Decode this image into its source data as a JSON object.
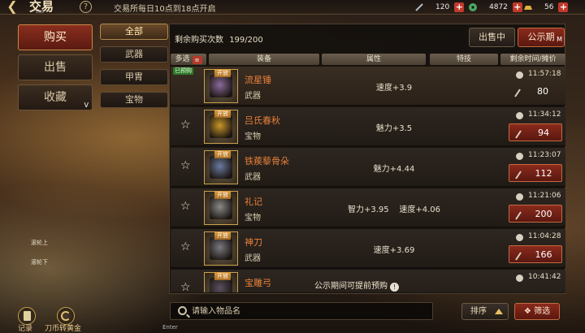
{
  "topbar": {
    "back_icon": "back-arrow-icon",
    "title": "交易",
    "help_glyph": "?",
    "esc_label": "Esc",
    "notice": "交易所每日10点到18点开启",
    "currencies": [
      {
        "icon": "dagger-token-icon",
        "value": "120",
        "color": "#b0b8c0"
      },
      {
        "icon": "jade-coin-icon",
        "value": "4872",
        "color": "#4caa66"
      },
      {
        "icon": "gold-ingot-icon",
        "value": "56",
        "color": "#e0b040"
      }
    ],
    "plus_glyph": "+"
  },
  "left_menu": {
    "buy": "购买",
    "sell": "出售",
    "favorites": "收藏",
    "v_hint": "V"
  },
  "categories": {
    "all": "全部",
    "weapon": "武器",
    "armor": "甲胄",
    "treasure": "宝物"
  },
  "panel": {
    "remaining_label": "剩余购买次数",
    "remaining_value": "199/200",
    "selling_btn": "出售中",
    "public_btn": "公示期",
    "m_hint": "M",
    "headers": {
      "multi": "多选",
      "multi_icon": "list-icon",
      "equip": "装备",
      "attr": "属性",
      "special": "特技",
      "time_price": "剩余时间/摊价"
    },
    "preorder_tag": "已预购",
    "open_tag": "开放"
  },
  "items": [
    {
      "name": "流星锤",
      "type": "武器",
      "attr": "速度+3.9",
      "time": "11:57:18",
      "price": "80",
      "starred": false,
      "preorder": true,
      "art": "#8a6a9a"
    },
    {
      "name": "吕氏春秋",
      "type": "宝物",
      "attr": "魅力+3.5",
      "time": "11:34:12",
      "price": "94",
      "starred": true,
      "preorder": false,
      "art": "#c9962a"
    },
    {
      "name": "铁蒺藜骨朵",
      "type": "武器",
      "attr": "魅力+4.44",
      "time": "11:23:07",
      "price": "112",
      "starred": true,
      "preorder": false,
      "art": "#6a7aa0"
    },
    {
      "name": "礼记",
      "type": "宝物",
      "attr": "智力+3.95    速度+4.06",
      "time": "11:21:06",
      "price": "200",
      "starred": true,
      "preorder": false,
      "art": "#8a8a88"
    },
    {
      "name": "神刀",
      "type": "武器",
      "attr": "速度+3.69",
      "time": "11:04:28",
      "price": "166",
      "starred": true,
      "preorder": false,
      "art": "#7a7a80"
    },
    {
      "name": "宝雕弓",
      "type": "",
      "attr": "",
      "time": "10:41:42",
      "price": "",
      "starred": true,
      "preorder": false,
      "art": "#5a5060"
    }
  ],
  "footer": {
    "note": "公示期间可提前预购",
    "info_glyph": "!",
    "search_placeholder": "请输入物品名",
    "sort": "排序",
    "filter": "筛选"
  },
  "side": {
    "scroll_up": "滚轮上",
    "scroll_down": "滚轮下",
    "record": "记录",
    "coin_to_gold": "刀币转黄金",
    "enter": "Enter"
  }
}
